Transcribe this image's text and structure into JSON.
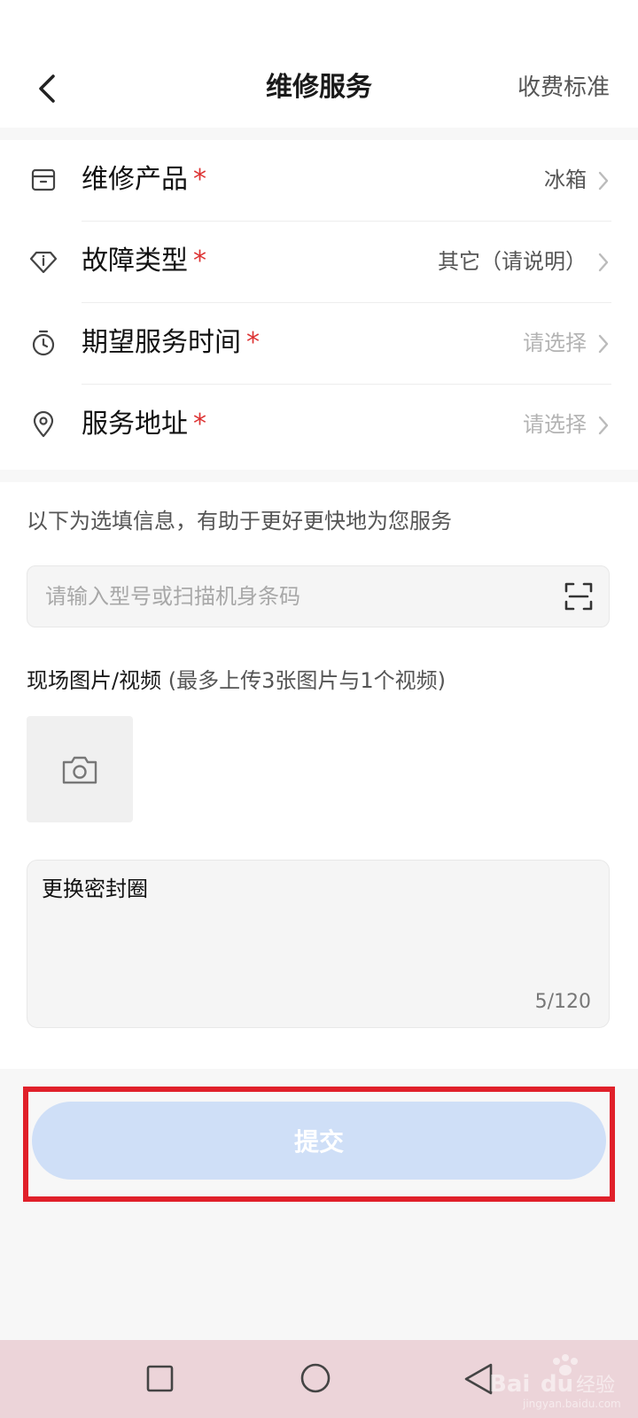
{
  "header": {
    "title": "维修服务",
    "right_link": "收费标准",
    "back_icon": "chevron-left-icon"
  },
  "required": {
    "star": "*",
    "rows": [
      {
        "label": "维修产品",
        "value": "冰箱",
        "placeholder": false,
        "icon": "box-icon"
      },
      {
        "label": "故障类型",
        "value": "其它（请说明）",
        "placeholder": false,
        "icon": "diamond-info-icon"
      },
      {
        "label": "期望服务时间",
        "value": "请选择",
        "placeholder": true,
        "icon": "stopwatch-icon"
      },
      {
        "label": "服务地址",
        "value": "请选择",
        "placeholder": true,
        "icon": "location-pin-icon"
      }
    ]
  },
  "optional": {
    "hint": "以下为选填信息，有助于更好更快地为您服务",
    "model_placeholder": "请输入型号或扫描机身条码",
    "media_label": "现场图片/视频",
    "media_sub": " (最多上传3张图片与1个视频)",
    "upload_icon": "camera-icon",
    "scan_icon": "scan-icon"
  },
  "notes": {
    "text": "更换密封圈",
    "counter": "5/120"
  },
  "submit": {
    "label": "提交"
  },
  "watermark": {
    "text": "Bai du 经验",
    "sub": "jingyan.baidu.com"
  },
  "colors": {
    "required_star": "#dd3333",
    "submit_bg": "#cfdff7",
    "highlight": "#e0202a",
    "navbar": "#ecd4d9"
  }
}
